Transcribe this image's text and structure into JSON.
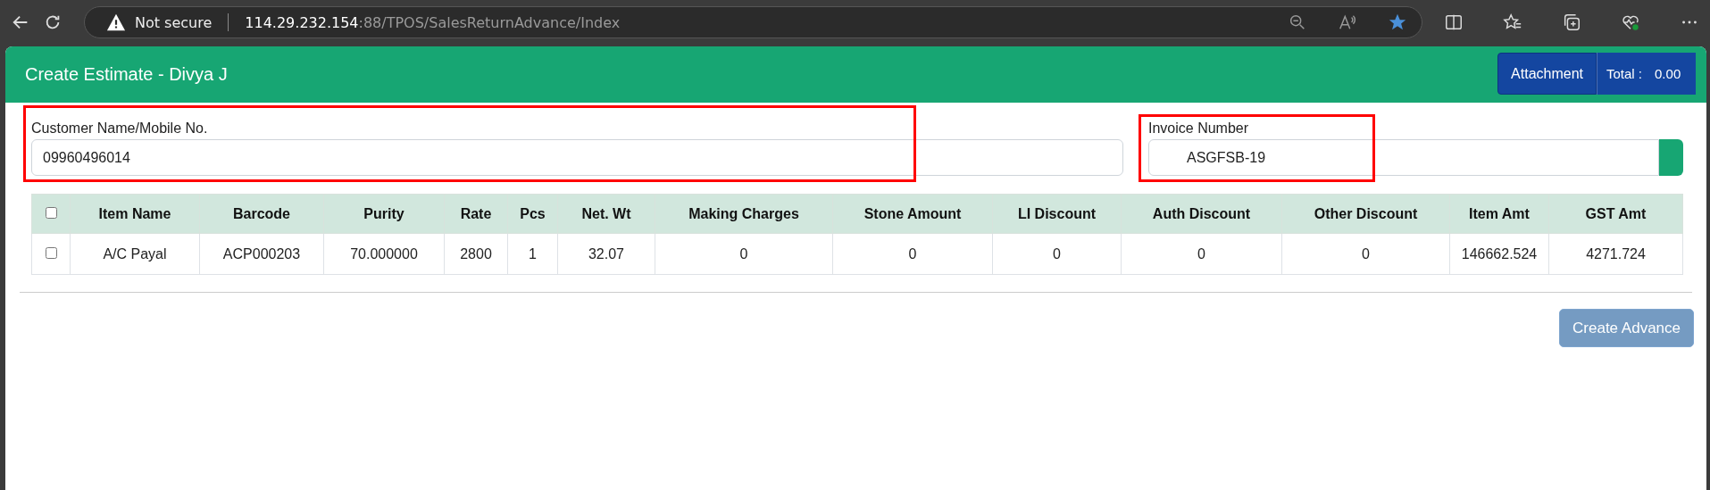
{
  "browser": {
    "security": "Not secure",
    "url_host": "114.29.232.154",
    "url_rest": ":88/TPOS/SalesReturnAdvance/Index"
  },
  "header": {
    "title": "Create Estimate - Divya J",
    "attachment_button": "Attachment",
    "total_label": "Total :",
    "total_value": "0.00"
  },
  "fields": [
    {
      "label": "Customer Name/Mobile No.",
      "value": "09960496014"
    },
    {
      "label": "Invoice Number",
      "value": "ASGFSB-19"
    }
  ],
  "table": {
    "select_all_checked": false,
    "columns": [
      "Item Name",
      "Barcode",
      "Purity",
      "Rate",
      "Pcs",
      "Net. Wt",
      "Making Charges",
      "Stone Amount",
      "LI Discount",
      "Auth Discount",
      "Other Discount",
      "Item Amt",
      "GST Amt"
    ],
    "rows": [
      {
        "checked": false,
        "cells": [
          "A/C Payal",
          "ACP000203",
          "70.000000",
          "2800",
          "1",
          "32.07",
          "0",
          "0",
          "0",
          "0",
          "0",
          "146662.524",
          "4271.724"
        ]
      }
    ]
  },
  "create_button": {
    "label": "Create Advance",
    "disabled": true
  }
}
